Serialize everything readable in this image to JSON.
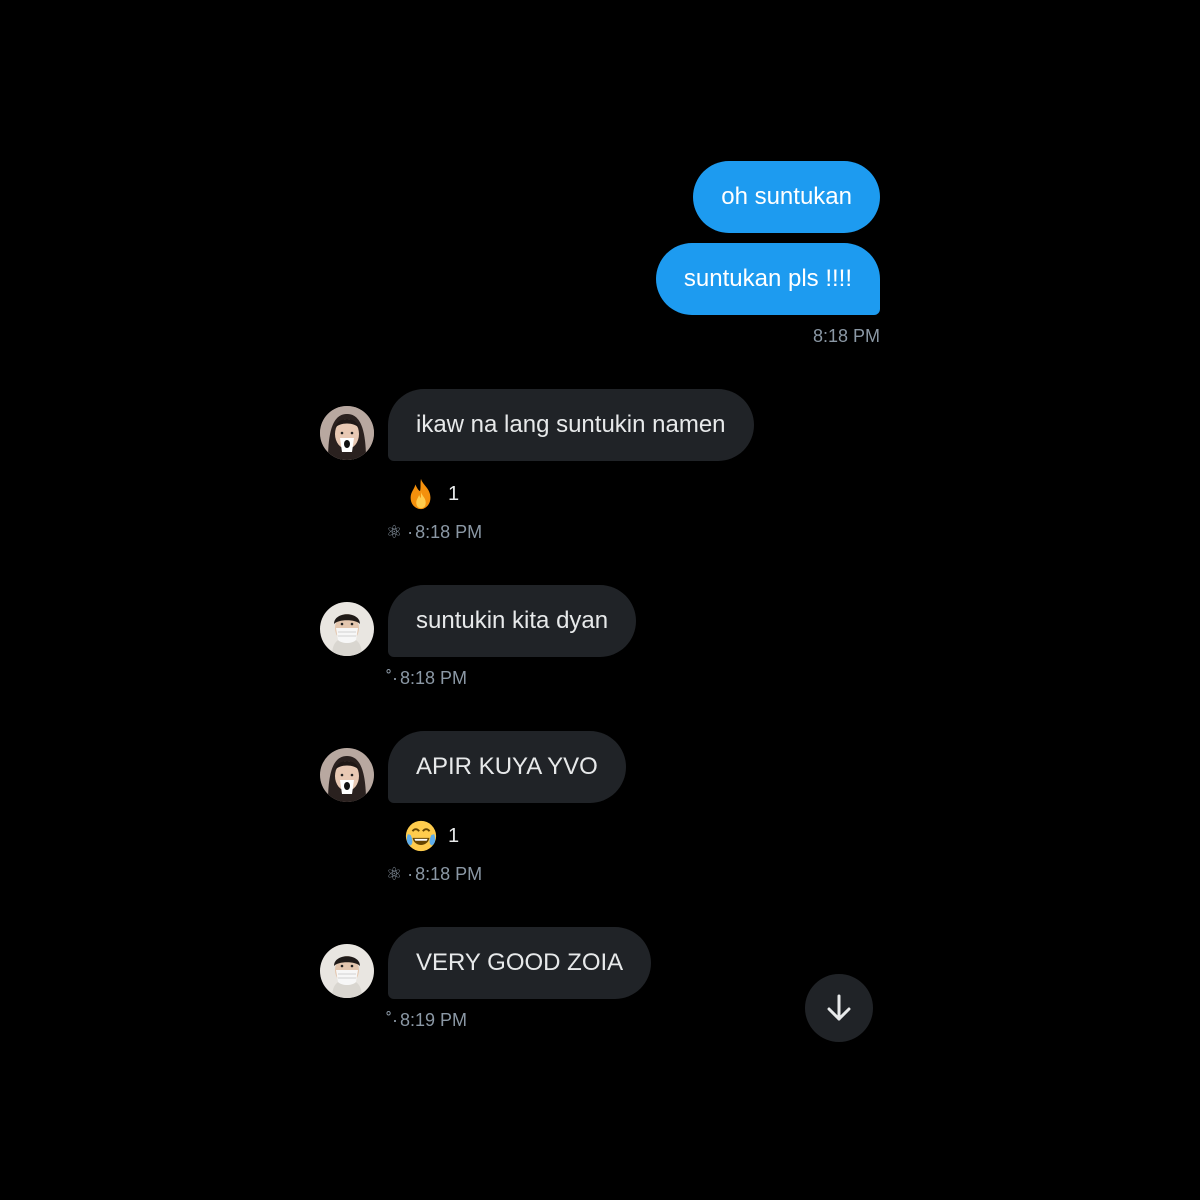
{
  "colors": {
    "background": "#000000",
    "outgoing_bubble": "#1d9bf0",
    "incoming_bubble": "#202327",
    "timestamp": "#8b98a5",
    "scroll_button": "#202327"
  },
  "messages": [
    {
      "direction": "outgoing",
      "text": "oh suntukan"
    },
    {
      "direction": "outgoing",
      "text": "suntukan pls !!!!",
      "time": "8:18 PM"
    },
    {
      "direction": "incoming",
      "avatar": "avatar-girl",
      "text": "ikaw na lang suntukin namen",
      "reaction_emoji": "fire",
      "reaction_count": "1",
      "meta_prefix": "⚛ · ",
      "time": "8:18 PM"
    },
    {
      "direction": "incoming",
      "avatar": "avatar-masked-boy",
      "text": "suntukin kita dyan",
      "meta_prefix": "˚· ",
      "time": "8:18 PM"
    },
    {
      "direction": "incoming",
      "avatar": "avatar-girl",
      "text": "APIR KUYA YVO",
      "reaction_emoji": "face-with-tears-of-joy",
      "reaction_count": "1",
      "meta_prefix": "⚛ · ",
      "time": "8:18 PM"
    },
    {
      "direction": "incoming",
      "avatar": "avatar-masked-boy",
      "text": "VERY GOOD ZOIA",
      "meta_prefix": "˚· ",
      "time": "8:19 PM"
    }
  ],
  "scroll_button": {
    "icon": "arrow-down-icon"
  }
}
